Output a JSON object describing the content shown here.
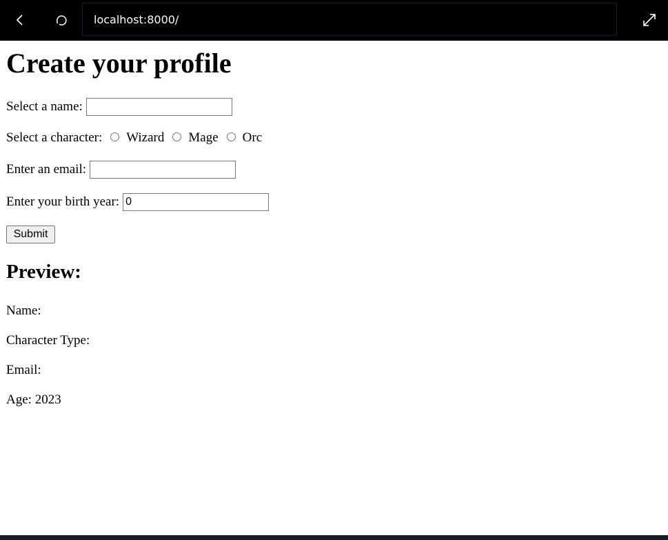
{
  "browser": {
    "url": "localhost:8000/"
  },
  "form": {
    "title": "Create your profile",
    "name_label": "Select a name:",
    "name_value": "",
    "character_label": "Select a character:",
    "character_options": [
      "Wizard",
      "Mage",
      "Orc"
    ],
    "email_label": "Enter an email:",
    "email_value": "",
    "birth_year_label": "Enter your birth year:",
    "birth_year_value": "0",
    "submit_label": "Submit"
  },
  "preview": {
    "heading": "Preview:",
    "name_label": "Name:",
    "character_label": "Character Type:",
    "email_label": "Email:",
    "age_label": "Age:",
    "age_value": "2023"
  }
}
